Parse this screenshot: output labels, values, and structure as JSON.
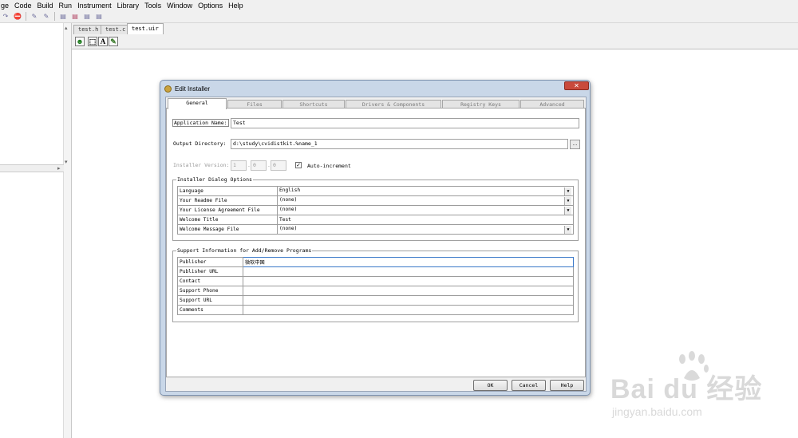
{
  "menu": [
    "ge",
    "Code",
    "Build",
    "Run",
    "Instrument",
    "Library",
    "Tools",
    "Window",
    "Options",
    "Help"
  ],
  "doc_tabs": [
    "test.h",
    "test.c",
    "test.uir"
  ],
  "dialog": {
    "title": "Edit Installer",
    "close": "✕",
    "tabs": [
      "General",
      "Files",
      "Shortcuts",
      "Drivers & Components",
      "Registry Keys",
      "Advanced"
    ],
    "app_name_label": "Application Name:",
    "app_name_value": "Test",
    "output_dir_label": "Output Directory:",
    "output_dir_value": "d:\\study\\cvidistkit.%name_1",
    "browse_label": "...",
    "version_label": "Installer Version:",
    "version": [
      "1",
      "0",
      "0"
    ],
    "version_sep": ".",
    "auto_increment_label": "Auto-increment",
    "auto_increment_checked": true,
    "dialog_options_title": "Installer Dialog Options",
    "dialog_options": [
      {
        "label": "Language",
        "value": "English",
        "dropdown": true
      },
      {
        "label": "Your Readme File",
        "value": "(none)",
        "dropdown": true
      },
      {
        "label": "Your License Agreement File",
        "value": "(none)",
        "dropdown": true
      },
      {
        "label": "Welcome Title",
        "value": "Test",
        "dropdown": false
      },
      {
        "label": "Welcome Message File",
        "value": "(none)",
        "dropdown": true
      }
    ],
    "support_title": "Support Information for Add/Remove Programs",
    "support_info": [
      {
        "label": "Publisher",
        "value": "微软中国"
      },
      {
        "label": "Publisher URL",
        "value": ""
      },
      {
        "label": "Contact",
        "value": ""
      },
      {
        "label": "Support Phone",
        "value": ""
      },
      {
        "label": "Support URL",
        "value": ""
      },
      {
        "label": "Comments",
        "value": ""
      }
    ],
    "buttons": {
      "ok": "OK",
      "cancel": "Cancel",
      "help": "Help"
    }
  },
  "watermark": {
    "brand": "Bai du 经验",
    "url": "jingyan.baidu.com"
  }
}
